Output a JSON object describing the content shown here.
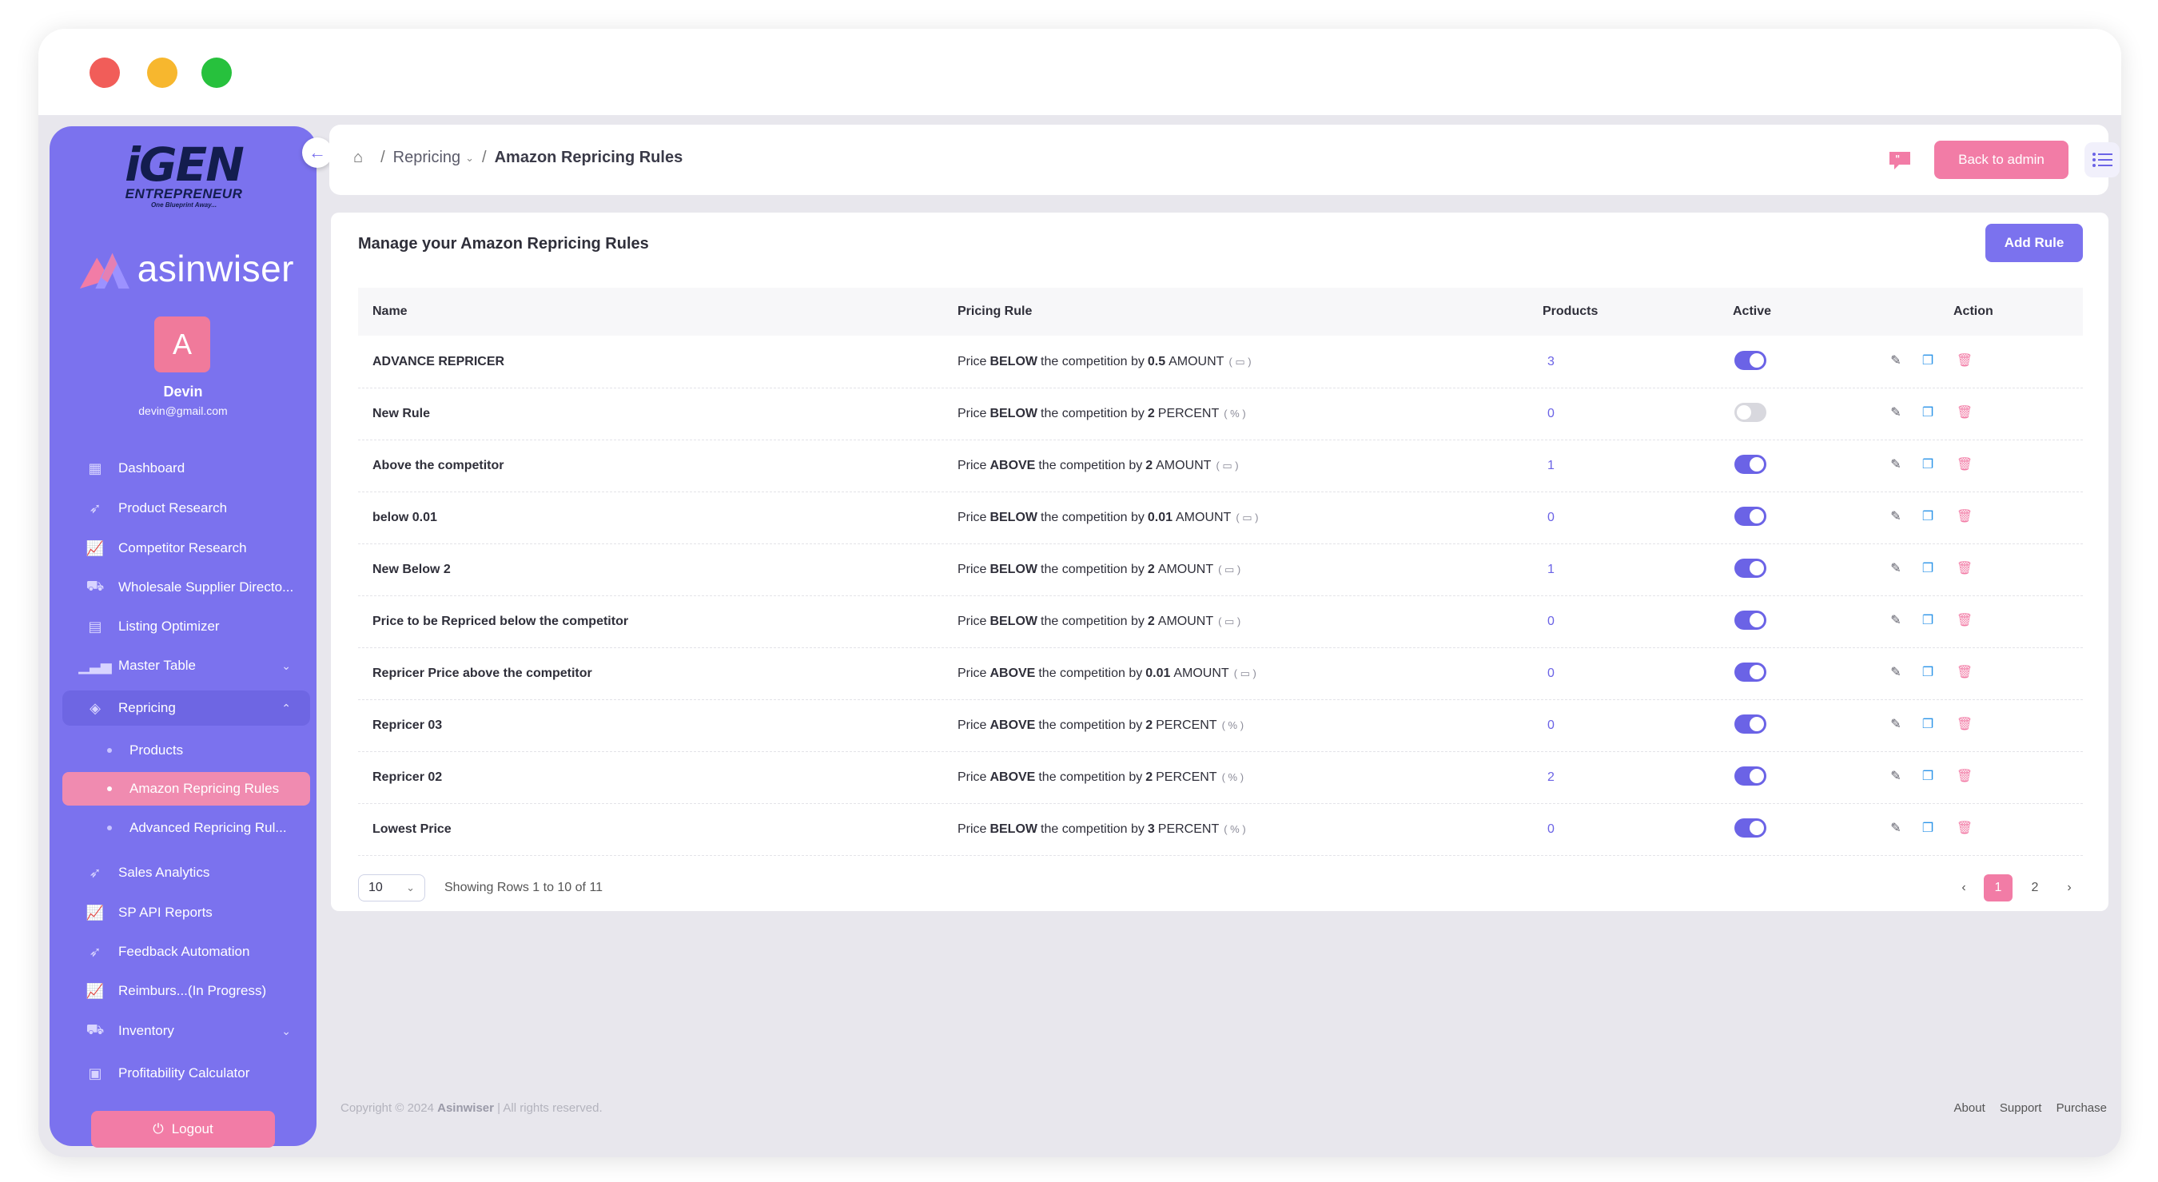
{
  "sidebar": {
    "logo_main": "iGEN",
    "logo_sub": "ENTREPRENEUR",
    "logo_tagline": "One Blueprint Away...",
    "brand": "asinwiser",
    "avatar_letter": "A",
    "user_name": "Devin",
    "user_email": "devin@gmail.com",
    "items": [
      {
        "label": "Dashboard",
        "icon": "grid-icon"
      },
      {
        "label": "Product Research",
        "icon": "rocket-icon"
      },
      {
        "label": "Competitor Research",
        "icon": "chart-icon"
      },
      {
        "label": "Wholesale Supplier Directo...",
        "icon": "truck-icon"
      },
      {
        "label": "Listing Optimizer",
        "icon": "document-icon"
      },
      {
        "label": "Master Table",
        "icon": "bar-chart-icon"
      },
      {
        "label": "Repricing",
        "icon": "layers-icon"
      },
      {
        "label": "Sales Analytics",
        "icon": "rocket-icon"
      },
      {
        "label": "SP API Reports",
        "icon": "chart-icon"
      },
      {
        "label": "Feedback Automation",
        "icon": "rocket-icon"
      },
      {
        "label": "Reimburs...(In Progress)",
        "icon": "chart-icon"
      },
      {
        "label": "Inventory",
        "icon": "truck-icon"
      },
      {
        "label": "Profitability Calculator",
        "icon": "calculator-icon"
      }
    ],
    "repricing_sub": [
      "Products",
      "Amazon Repricing Rules",
      "Advanced Repricing Rul..."
    ],
    "logout": "Logout"
  },
  "header": {
    "breadcrumb": [
      "Repricing",
      "Amazon Repricing Rules"
    ],
    "back_to_admin": "Back to admin"
  },
  "card": {
    "title": "Manage your Amazon Repricing Rules",
    "add_rule": "Add Rule",
    "columns": [
      "Name",
      "Pricing Rule",
      "Products",
      "Active",
      "Action"
    ],
    "rule_prefix": "Price",
    "rule_middle": "the competition by",
    "rows": [
      {
        "name": "ADVANCE REPRICER",
        "direction": "BELOW",
        "value": "0.5",
        "unit": "AMOUNT",
        "products": "3",
        "active": true
      },
      {
        "name": "New Rule",
        "direction": "BELOW",
        "value": "2",
        "unit": "PERCENT",
        "products": "0",
        "active": false
      },
      {
        "name": "Above the competitor",
        "direction": "ABOVE",
        "value": "2",
        "unit": "AMOUNT",
        "products": "1",
        "active": true
      },
      {
        "name": "below 0.01",
        "direction": "BELOW",
        "value": "0.01",
        "unit": "AMOUNT",
        "products": "0",
        "active": true
      },
      {
        "name": "New Below 2",
        "direction": "BELOW",
        "value": "2",
        "unit": "AMOUNT",
        "products": "1",
        "active": true
      },
      {
        "name": "Price to be Repriced below the competitor",
        "direction": "BELOW",
        "value": "2",
        "unit": "AMOUNT",
        "products": "0",
        "active": true
      },
      {
        "name": "Repricer Price above the competitor",
        "direction": "ABOVE",
        "value": "0.01",
        "unit": "AMOUNT",
        "products": "0",
        "active": true
      },
      {
        "name": "Repricer 03",
        "direction": "ABOVE",
        "value": "2",
        "unit": "PERCENT",
        "products": "0",
        "active": true
      },
      {
        "name": "Repricer 02",
        "direction": "ABOVE",
        "value": "2",
        "unit": "PERCENT",
        "products": "2",
        "active": true
      },
      {
        "name": "Lowest Price",
        "direction": "BELOW",
        "value": "3",
        "unit": "PERCENT",
        "products": "0",
        "active": true
      }
    ],
    "per_page": "10",
    "showing": "Showing Rows 1 to 10 of 11",
    "pages": [
      "1",
      "2"
    ],
    "current_page": "1"
  },
  "footer": {
    "copyright_prefix": "Copyright © 2024",
    "company": "Asinwiser",
    "rights": "| All rights reserved.",
    "links": [
      "About",
      "Support",
      "Purchase"
    ]
  },
  "colors": {
    "sidebar": "#7b72ee",
    "accent_pink": "#f27ca6",
    "accent_purple": "#7b72ee",
    "copy_blue": "#2a93e8"
  }
}
